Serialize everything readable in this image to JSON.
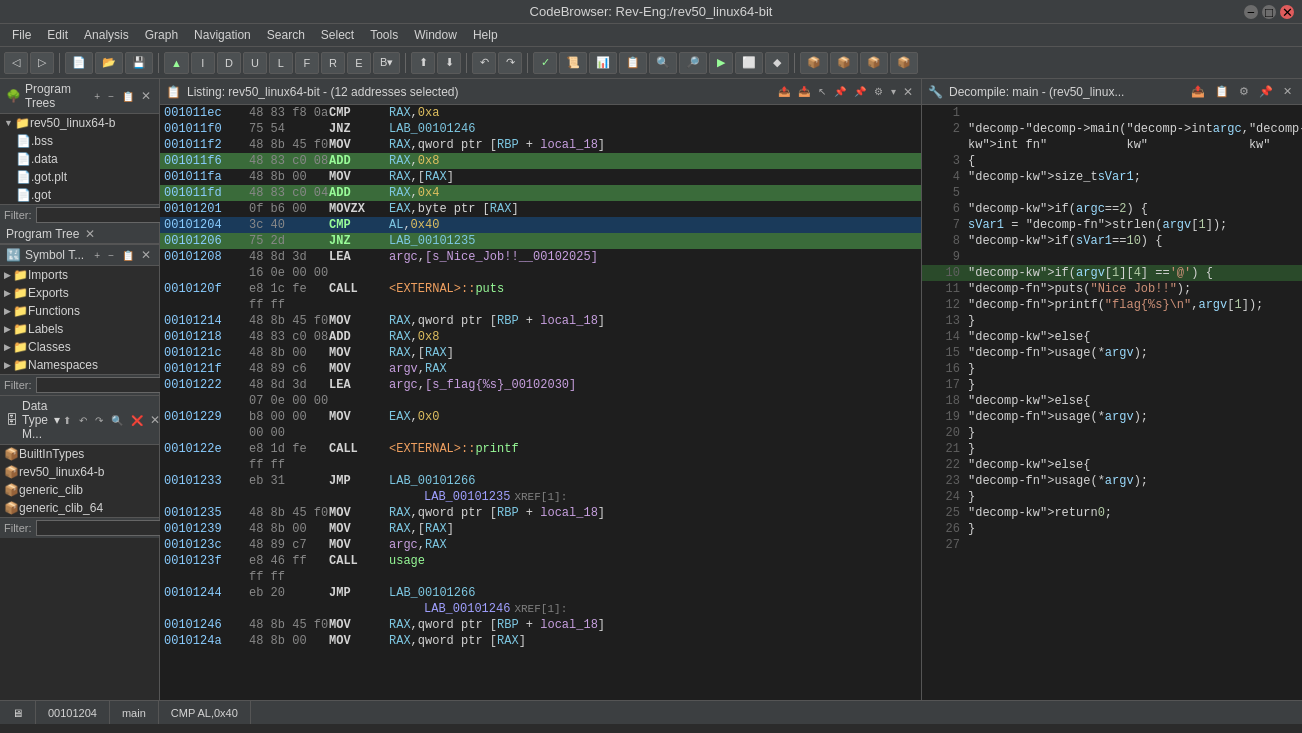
{
  "titlebar": {
    "title": "CodeBrowser: Rev-Eng:/rev50_linux64-bit"
  },
  "menubar": {
    "items": [
      "File",
      "Edit",
      "Analysis",
      "Graph",
      "Navigation",
      "Search",
      "Select",
      "Tools",
      "Window",
      "Help"
    ]
  },
  "programTrees": {
    "label": "Program Trees",
    "close": "×",
    "tree": {
      "root": "rev50_linux64-b",
      "children": [
        ".bss",
        ".data",
        ".got.plt",
        ".got"
      ]
    },
    "filter": {
      "label": "Filter:",
      "placeholder": ""
    }
  },
  "programTree": {
    "label": "Program Tree",
    "close": "×"
  },
  "symbolTree": {
    "label": "Symbol T...",
    "items": [
      "Imports",
      "Exports",
      "Functions",
      "Labels",
      "Classes",
      "Namespaces"
    ]
  },
  "dataTypeManager": {
    "label": "Data Type M...",
    "items": [
      "BuiltInTypes",
      "rev50_linux64-b",
      "generic_clib",
      "generic_clib_64"
    ]
  },
  "listing": {
    "header": "Listing:  rev50_linux64-bit - (12 addresses selected)",
    "lines": [
      {
        "addr": "001011ec",
        "hex": "48 83 f8 0a",
        "mnem": "CMP",
        "ops": "RAX,0xa",
        "highlight": false
      },
      {
        "addr": "001011f0",
        "hex": "75 54",
        "mnem": "JNZ",
        "ops": "LAB_00101246",
        "highlight": false
      },
      {
        "addr": "001011f2",
        "hex": "48 8b 45 f0",
        "mnem": "MOV",
        "ops": "RAX,qword ptr [RBP + local_18]",
        "highlight": false
      },
      {
        "addr": "001011f6",
        "hex": "48 83 c0 08",
        "mnem": "ADD",
        "ops": "RAX,0x8",
        "highlight": true
      },
      {
        "addr": "001011fa",
        "hex": "48 8b 00",
        "mnem": "MOV",
        "ops": "RAX,[RAX]",
        "highlight": false
      },
      {
        "addr": "001011fd",
        "hex": "48 83 c0 04",
        "mnem": "ADD",
        "ops": "RAX,0x4",
        "highlight": true
      },
      {
        "addr": "00101201",
        "hex": "0f b6 00",
        "mnem": "MOVZX",
        "ops": "EAX,byte ptr [RAX]",
        "highlight": false
      },
      {
        "addr": "00101204",
        "hex": "3c 40",
        "mnem": "CMP",
        "ops": "AL,0x40",
        "highlight": true,
        "selected": true
      },
      {
        "addr": "00101206",
        "hex": "75 2d",
        "mnem": "JNZ",
        "ops": "LAB_00101235",
        "highlight": true
      },
      {
        "addr": "00101208",
        "hex": "48 8d 3d",
        "mnem": "LEA",
        "ops": "argc,[s_Nice_Job!!__00102025]",
        "highlight": false
      },
      {
        "addr": "",
        "hex": "16 0e 00 00",
        "mnem": "",
        "ops": "",
        "highlight": false
      },
      {
        "addr": "0010120f",
        "hex": "e8 1c fe",
        "mnem": "CALL",
        "ops": "<EXTERNAL>::puts",
        "highlight": false
      },
      {
        "addr": "",
        "hex": "ff ff",
        "mnem": "",
        "ops": "",
        "highlight": false
      },
      {
        "addr": "00101214",
        "hex": "48 8b 45 f0",
        "mnem": "MOV",
        "ops": "RAX,qword ptr [RBP + local_18]",
        "highlight": false
      },
      {
        "addr": "00101218",
        "hex": "48 83 c0 08",
        "mnem": "ADD",
        "ops": "RAX,0x8",
        "highlight": false
      },
      {
        "addr": "0010121c",
        "hex": "48 8b 00",
        "mnem": "MOV",
        "ops": "RAX,[RAX]",
        "highlight": false
      },
      {
        "addr": "0010121f",
        "hex": "48 89 c6",
        "mnem": "MOV",
        "ops": "argv,RAX",
        "highlight": false
      },
      {
        "addr": "00101222",
        "hex": "48 8d 3d",
        "mnem": "LEA",
        "ops": "argc,[s_flag{%s}_00102030]",
        "highlight": false
      },
      {
        "addr": "",
        "hex": "07 0e 00 00",
        "mnem": "",
        "ops": "",
        "highlight": false
      },
      {
        "addr": "00101229",
        "hex": "b8 00 00",
        "mnem": "MOV",
        "ops": "EAX,0x0",
        "highlight": false
      },
      {
        "addr": "",
        "hex": "00 00",
        "mnem": "",
        "ops": "",
        "highlight": false
      },
      {
        "addr": "0010122e",
        "hex": "e8 1d fe",
        "mnem": "CALL",
        "ops": "<EXTERNAL>::printf",
        "highlight": false
      },
      {
        "addr": "",
        "hex": "ff ff",
        "mnem": "",
        "ops": "",
        "highlight": false
      },
      {
        "addr": "00101233",
        "hex": "eb 31",
        "mnem": "JMP",
        "ops": "LAB_00101266",
        "highlight": false
      },
      {
        "addr": "label",
        "hex": "",
        "mnem": "",
        "ops": "LAB_00101235",
        "label": true,
        "xref": "XREF[1]:"
      },
      {
        "addr": "00101235",
        "hex": "48 8b 45 f0",
        "mnem": "MOV",
        "ops": "RAX,qword ptr [RBP + local_18]",
        "highlight": false
      },
      {
        "addr": "00101239",
        "hex": "48 8b 00",
        "mnem": "MOV",
        "ops": "RAX,[RAX]",
        "highlight": false
      },
      {
        "addr": "0010123c",
        "hex": "48 89 c7",
        "mnem": "MOV",
        "ops": "argc,RAX",
        "highlight": false
      },
      {
        "addr": "0010123f",
        "hex": "e8 46 ff",
        "mnem": "CALL",
        "ops": "usage",
        "highlight": false
      },
      {
        "addr": "",
        "hex": "ff ff",
        "mnem": "",
        "ops": "",
        "highlight": false
      },
      {
        "addr": "00101244",
        "hex": "eb 20",
        "mnem": "JMP",
        "ops": "LAB_00101266",
        "highlight": false
      },
      {
        "addr": "label2",
        "hex": "",
        "mnem": "",
        "ops": "LAB_00101246",
        "label": true,
        "xref": "XREF[1]:"
      },
      {
        "addr": "00101246",
        "hex": "48 8b 45 f0",
        "mnem": "MOV",
        "ops": "RAX,qword ptr [RBP + local_18]",
        "highlight": false
      },
      {
        "addr": "0010124a",
        "hex": "48 8b 00",
        "mnem": "MOV",
        "ops": "RAX,qword ptr [RAX]",
        "highlight": false
      }
    ]
  },
  "decompile": {
    "header": "Decompile: main - (rev50_linux...",
    "lines": [
      {
        "num": 1,
        "code": ""
      },
      {
        "num": 2,
        "code": "int main(int argc,char **argv)"
      },
      {
        "num": 3,
        "code": "{"
      },
      {
        "num": 4,
        "code": "  size_t sVar1;"
      },
      {
        "num": 5,
        "code": ""
      },
      {
        "num": 6,
        "code": "  if (argc == 2) {"
      },
      {
        "num": 7,
        "code": "    sVar1 = strlen(argv[1]);"
      },
      {
        "num": 8,
        "code": "    if (sVar1 == 10) {"
      },
      {
        "num": 9,
        "code": ""
      },
      {
        "num": 10,
        "code": "      if (argv[1][4] == '@') {",
        "highlight": true
      },
      {
        "num": 11,
        "code": "        puts(\"Nice Job!!\");"
      },
      {
        "num": 12,
        "code": "        printf(\"flag{%s}\\n\",argv[1]);"
      },
      {
        "num": 13,
        "code": "      }"
      },
      {
        "num": 14,
        "code": "      else {"
      },
      {
        "num": 15,
        "code": "        usage(*argv);"
      },
      {
        "num": 16,
        "code": "      }"
      },
      {
        "num": 17,
        "code": "    }"
      },
      {
        "num": 18,
        "code": "    else {"
      },
      {
        "num": 19,
        "code": "      usage(*argv);"
      },
      {
        "num": 20,
        "code": "    }"
      },
      {
        "num": 21,
        "code": "  }"
      },
      {
        "num": 22,
        "code": "  else {"
      },
      {
        "num": 23,
        "code": "    usage(*argv);"
      },
      {
        "num": 24,
        "code": "  }"
      },
      {
        "num": 25,
        "code": "  return 0;"
      },
      {
        "num": 26,
        "code": "}"
      },
      {
        "num": 27,
        "code": ""
      }
    ]
  },
  "statusbar": {
    "address": "00101204",
    "function": "main",
    "instruction": "CMP AL,0x40"
  }
}
